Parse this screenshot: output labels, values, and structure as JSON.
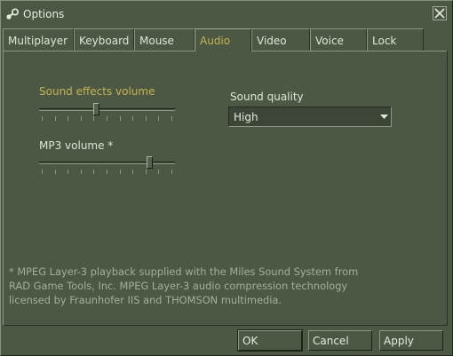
{
  "window": {
    "title": "Options",
    "close_label": "X"
  },
  "tabs": [
    {
      "label": "Multiplayer",
      "active": false
    },
    {
      "label": "Keyboard",
      "active": false
    },
    {
      "label": "Mouse",
      "active": false
    },
    {
      "label": "Audio",
      "active": true
    },
    {
      "label": "Video",
      "active": false
    },
    {
      "label": "Voice",
      "active": false
    },
    {
      "label": "Lock",
      "active": false
    }
  ],
  "audio": {
    "sound_effects_label": "Sound effects volume",
    "sound_effects_level": 0.42,
    "mp3_label": "MP3 volume *",
    "mp3_level": 0.83,
    "quality_label": "Sound quality",
    "quality_value": "High",
    "footnote": "* MPEG Layer-3 playback supplied with the Miles Sound System from\nRAD Game Tools, Inc. MPEG Layer-3 audio compression technology\nlicensed by Fraunhofer IIS and THOMSON multimedia."
  },
  "buttons": {
    "ok": "OK",
    "cancel": "Cancel",
    "apply": "Apply"
  },
  "colors": {
    "background": "#4c5844",
    "accent_text": "#c4b550",
    "text": "#dfe5d8"
  }
}
